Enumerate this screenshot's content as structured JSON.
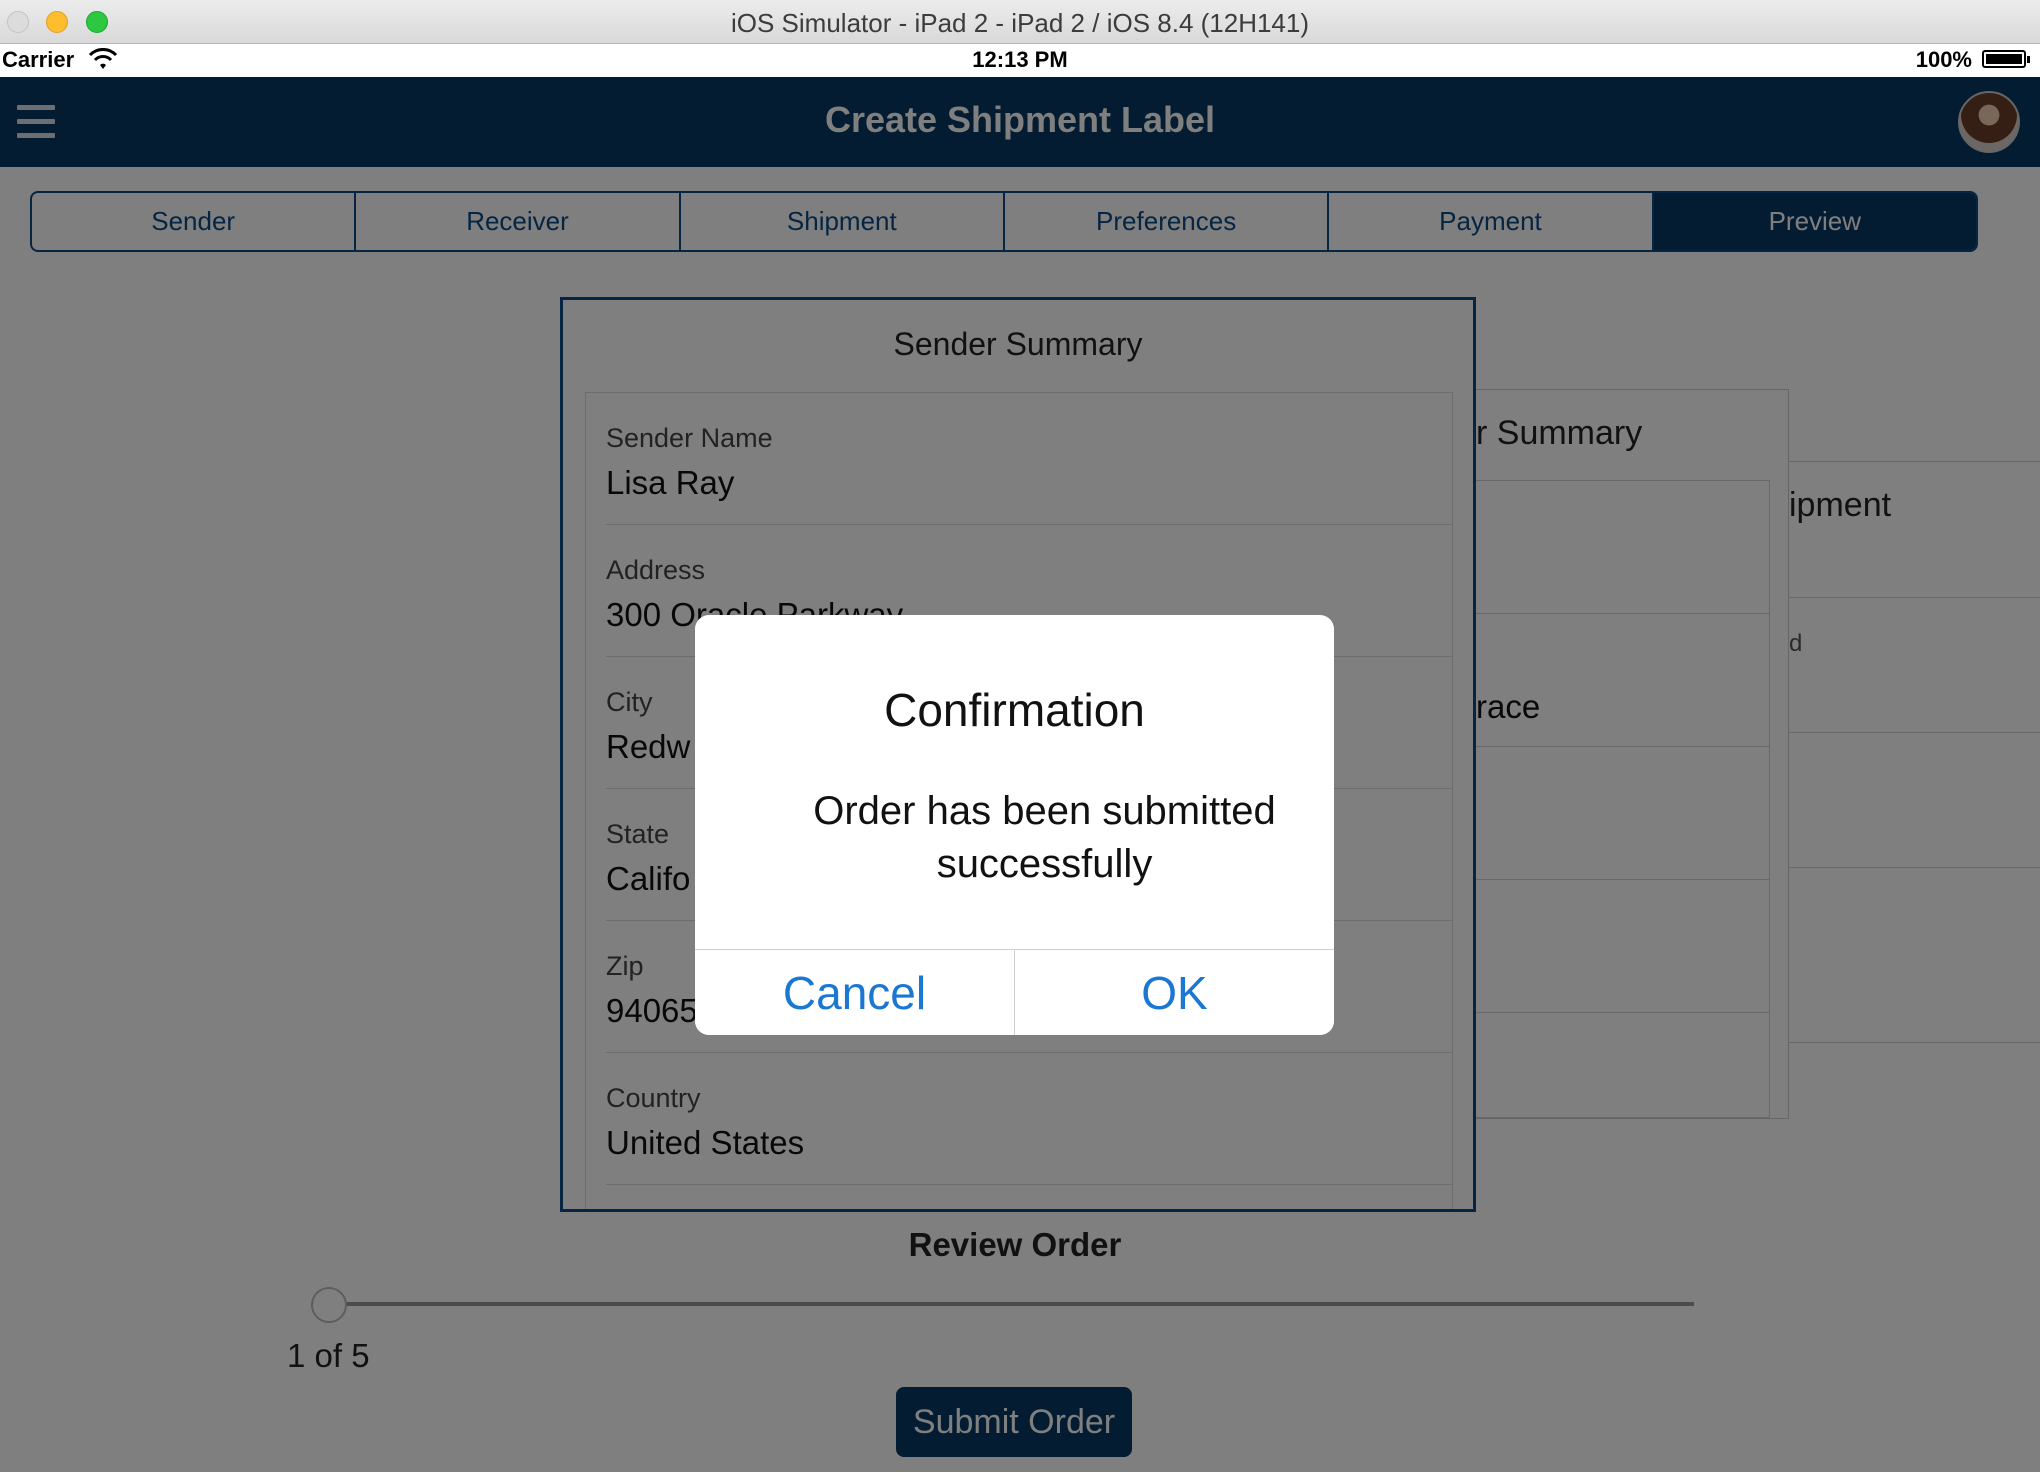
{
  "window": {
    "title": "iOS Simulator - iPad 2 - iPad 2 / iOS 8.4 (12H141)"
  },
  "status_bar": {
    "carrier": "Carrier",
    "time": "12:13 PM",
    "battery": "100%"
  },
  "header": {
    "title": "Create Shipment Label"
  },
  "tabs": [
    {
      "label": "Sender"
    },
    {
      "label": "Receiver"
    },
    {
      "label": "Shipment"
    },
    {
      "label": "Preferences"
    },
    {
      "label": "Payment"
    },
    {
      "label": "Preview",
      "active": true
    }
  ],
  "sender_summary": {
    "title": "Sender Summary",
    "fields": [
      {
        "label": "Sender Name",
        "value": "Lisa Ray"
      },
      {
        "label": "Address",
        "value": "300 Oracle Parkway"
      },
      {
        "label": "City",
        "value": "Redw"
      },
      {
        "label": "State",
        "value": "Califo"
      },
      {
        "label": "Zip",
        "value": "94065"
      },
      {
        "label": "Country",
        "value": "United States"
      }
    ]
  },
  "receiver_summary": {
    "title": "r Summary",
    "visible_value": "race"
  },
  "shipment_summary": {
    "title": "ipment",
    "visible_label": "d"
  },
  "review": {
    "title": "Review Order",
    "position": "1 of 5",
    "current": 1,
    "total": 5
  },
  "submit_label": "Submit Order",
  "dialog": {
    "title": "Confirmation",
    "message": "Order has been submitted successfully",
    "cancel_label": "Cancel",
    "ok_label": "OK"
  },
  "colors": {
    "header_bg": "#063863",
    "accent": "#0a4a84",
    "link": "#1a78d2"
  }
}
